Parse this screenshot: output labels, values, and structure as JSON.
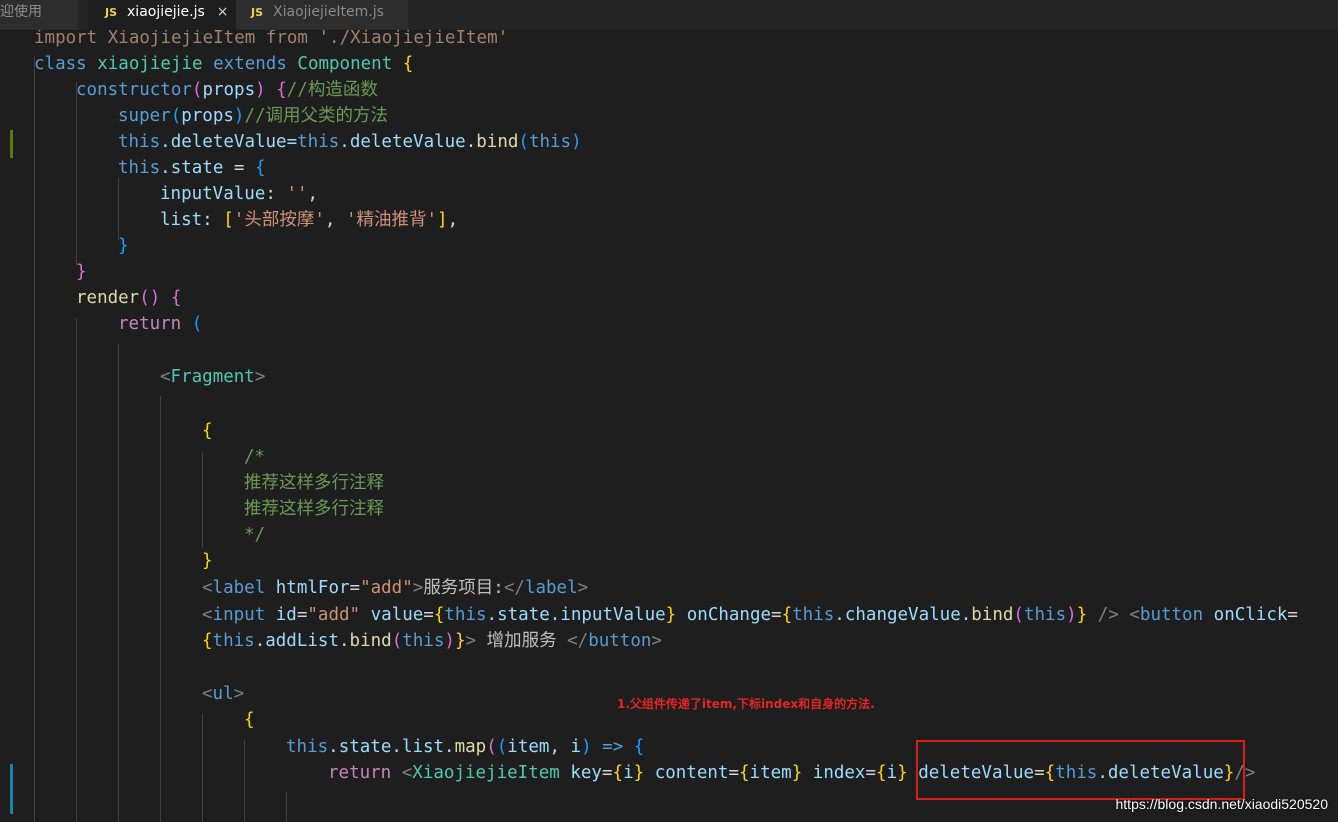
{
  "tabs": [
    {
      "label": "迎使用",
      "type": "text",
      "active": false
    },
    {
      "label": "xiaojiejie.js",
      "type": "js",
      "active": true,
      "close": "×"
    },
    {
      "label": "XiaojiejieItem.js",
      "type": "js",
      "active": false
    }
  ],
  "js_badge": "JS",
  "code": {
    "l1": {
      "a": "import ",
      "b": "XiaojiejieItem",
      "c": " from ",
      "d": "'./XiaojiejieItem'"
    },
    "l2": {
      "a": "class ",
      "b": "xiaojiejie",
      "c": " extends ",
      "d": "Component",
      "e": " {"
    },
    "l3": {
      "a": "constructor",
      "b": "(",
      "c": "props",
      "d": ") ",
      "e": "{",
      "f": "//构造函数"
    },
    "l4": {
      "a": "super",
      "b": "(",
      "c": "props",
      "d": ")",
      "e": "//调用父类的方法"
    },
    "l5": {
      "a": "this",
      "b": ".deleteValue=",
      "c": "this",
      "d": ".deleteValue.",
      "e": "bind",
      "f": "(",
      "g": "this",
      "h": ")"
    },
    "l6": {
      "a": "this",
      "b": ".state",
      "c": " = ",
      "d": "{"
    },
    "l7": {
      "a": "inputValue",
      "b": ": ",
      "c": "''",
      "d": ","
    },
    "l8": {
      "a": "list",
      "b": ": ",
      "c": "[",
      "d": "'头部按摩'",
      "e": ", ",
      "f": "'精油推背'",
      "g": "]",
      "h": ","
    },
    "l9": {
      "a": "}"
    },
    "l10": {
      "a": "}"
    },
    "l11": {
      "a": "render",
      "b": "() ",
      "c": "{"
    },
    "l12": {
      "a": "return",
      "b": " ",
      "c": "("
    },
    "l14": {
      "a": "<",
      "b": "Fragment",
      "c": ">"
    },
    "l16": {
      "a": "{"
    },
    "l17": {
      "a": "/*"
    },
    "l18": {
      "a": "推荐这样多行注释"
    },
    "l19": {
      "a": "推荐这样多行注释"
    },
    "l20": {
      "a": "*/"
    },
    "l21": {
      "a": "}"
    },
    "l22": {
      "a": "<",
      "b": "label",
      "c": " htmlFor",
      "d": "=",
      "e": "\"add\"",
      "f": ">",
      "g": "服务项目:",
      "h": "</",
      "i": "label",
      "j": ">"
    },
    "l23": {
      "a": "<",
      "b": "input",
      "c": " id",
      "d": "=",
      "e": "\"add\"",
      "f": " value",
      "g": "=",
      "h": "{",
      "i": "this",
      "j": ".state.inputValue",
      "k": "}",
      "l": " onChange",
      "m": "=",
      "n": "{",
      "o": "this",
      "p": ".changeValue.",
      "q": "bind",
      "r": "(",
      "s": "this",
      "t": ")",
      "u": "}",
      "v": " />",
      "w": " <",
      "x": "button",
      "y": " onClick",
      "z": "="
    },
    "l24": {
      "a": "{",
      "b": "this",
      "c": ".addList.",
      "d": "bind",
      "e": "(",
      "f": "this",
      "g": ")",
      "h": "}",
      "i": ">",
      "j": " 增加服务 ",
      "k": "</",
      "l": "button",
      "m": ">"
    },
    "l26": {
      "a": "<",
      "b": "ul",
      "c": ">"
    },
    "l27": {
      "a": "{"
    },
    "l28": {
      "a": "this",
      "b": ".state.list.",
      "c": "map",
      "d": "(",
      "e": "(",
      "f": "item",
      "g": ", ",
      "h": "i",
      "i": ")",
      "j": " => ",
      "k": "{"
    },
    "l29": {
      "a": "return",
      "b": " <",
      "c": "XiaojiejieItem",
      "d": " key",
      "e": "=",
      "f": "{",
      "g": "i",
      "h": "}",
      "i": " content",
      "j": "=",
      "k": "{",
      "l": "item",
      "m": "}",
      "n": " index",
      "o": "=",
      "p": "{",
      "q": "i",
      "r": "}",
      "s": " deleteValue",
      "t": "=",
      "u": "{",
      "v": "this",
      "w": ".deleteValue",
      "x": "}",
      "y": "/>"
    }
  },
  "annotation": "1.父组件传递了item,下标index和自身的方法.",
  "watermark": "https://blog.csdn.net/xiaodi520520"
}
